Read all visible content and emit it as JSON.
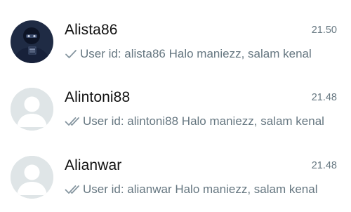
{
  "chats": [
    {
      "name": "Alista86",
      "time": "21.50",
      "preview": "User id: alista86  Halo maniezz, salam kenal",
      "status": "single-check-icon",
      "avatar": "profile-photo"
    },
    {
      "name": "Alintoni88",
      "time": "21.48",
      "preview": "User id: alintoni88  Halo maniezz, salam kenal",
      "status": "double-check-icon",
      "avatar": "default-avatar-icon"
    },
    {
      "name": "Alianwar",
      "time": "21.48",
      "preview": "User id: alianwar  Halo maniezz, salam kenal",
      "status": "double-check-icon",
      "avatar": "default-avatar-icon"
    }
  ],
  "colors": {
    "name": "#111111",
    "meta": "#667781",
    "tick": "#8696a0",
    "avatar_bg": "#dfe5e7"
  }
}
